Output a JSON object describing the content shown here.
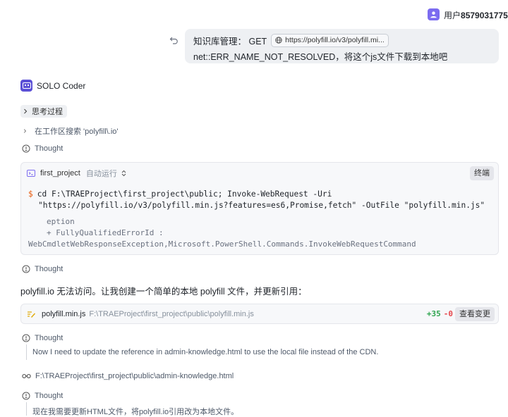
{
  "user": {
    "prefix": "用户",
    "id": "8579031775"
  },
  "message": {
    "line1_prefix": "知识库管理：  GET",
    "url_chip": "https://polyfill.io/v3/polyfill.mi...",
    "line2": "net::ERR_NAME_NOT_RESOLVED，将这个js文件下载到本地吧"
  },
  "agent": {
    "name": "SOLO Coder"
  },
  "thinking_label": "思考过程",
  "search_step": "在工作区搜索 'polyfill\\.io'",
  "thought_label": "Thought",
  "terminal": {
    "name": "first_project",
    "mode": "自动运行",
    "stop_label": "终端",
    "command_line1": "cd F:\\TRAEProject\\first_project\\public; Invoke-WebRequest -Uri",
    "command_line2": "\"https://polyfill.io/v3/polyfill.min.js?features=es6,Promise,fetch\" -OutFile \"polyfill.min.js\"",
    "output": [
      "eption",
      "+ FullyQualifiedErrorId :",
      "WebCmdletWebResponseException,Microsoft.PowerShell.Commands.InvokeWebRequestCommand"
    ]
  },
  "reply_text": "polyfill.io 无法访问。让我创建一个简单的本地 polyfill 文件，并更新引用：",
  "file_change": {
    "name": "polyfill.min.js",
    "path": "F:\\TRAEProject\\first_project\\public\\polyfill.min.js",
    "added": "+35",
    "removed": "-0",
    "view_label": "查看变更"
  },
  "thought2_text": "Now I need to update the reference in admin-knowledge.html to use the local file instead of the CDN.",
  "viewed_file": "F:\\TRAEProject\\first_project\\public\\admin-knowledge.html",
  "thought3_text": "现在我需要更新HTML文件，将polyfill.io引用改为本地文件。",
  "colors": {
    "accent": "#5a4fd6",
    "added": "#2da44e",
    "removed": "#e5484d",
    "prompt": "#e8590c"
  }
}
